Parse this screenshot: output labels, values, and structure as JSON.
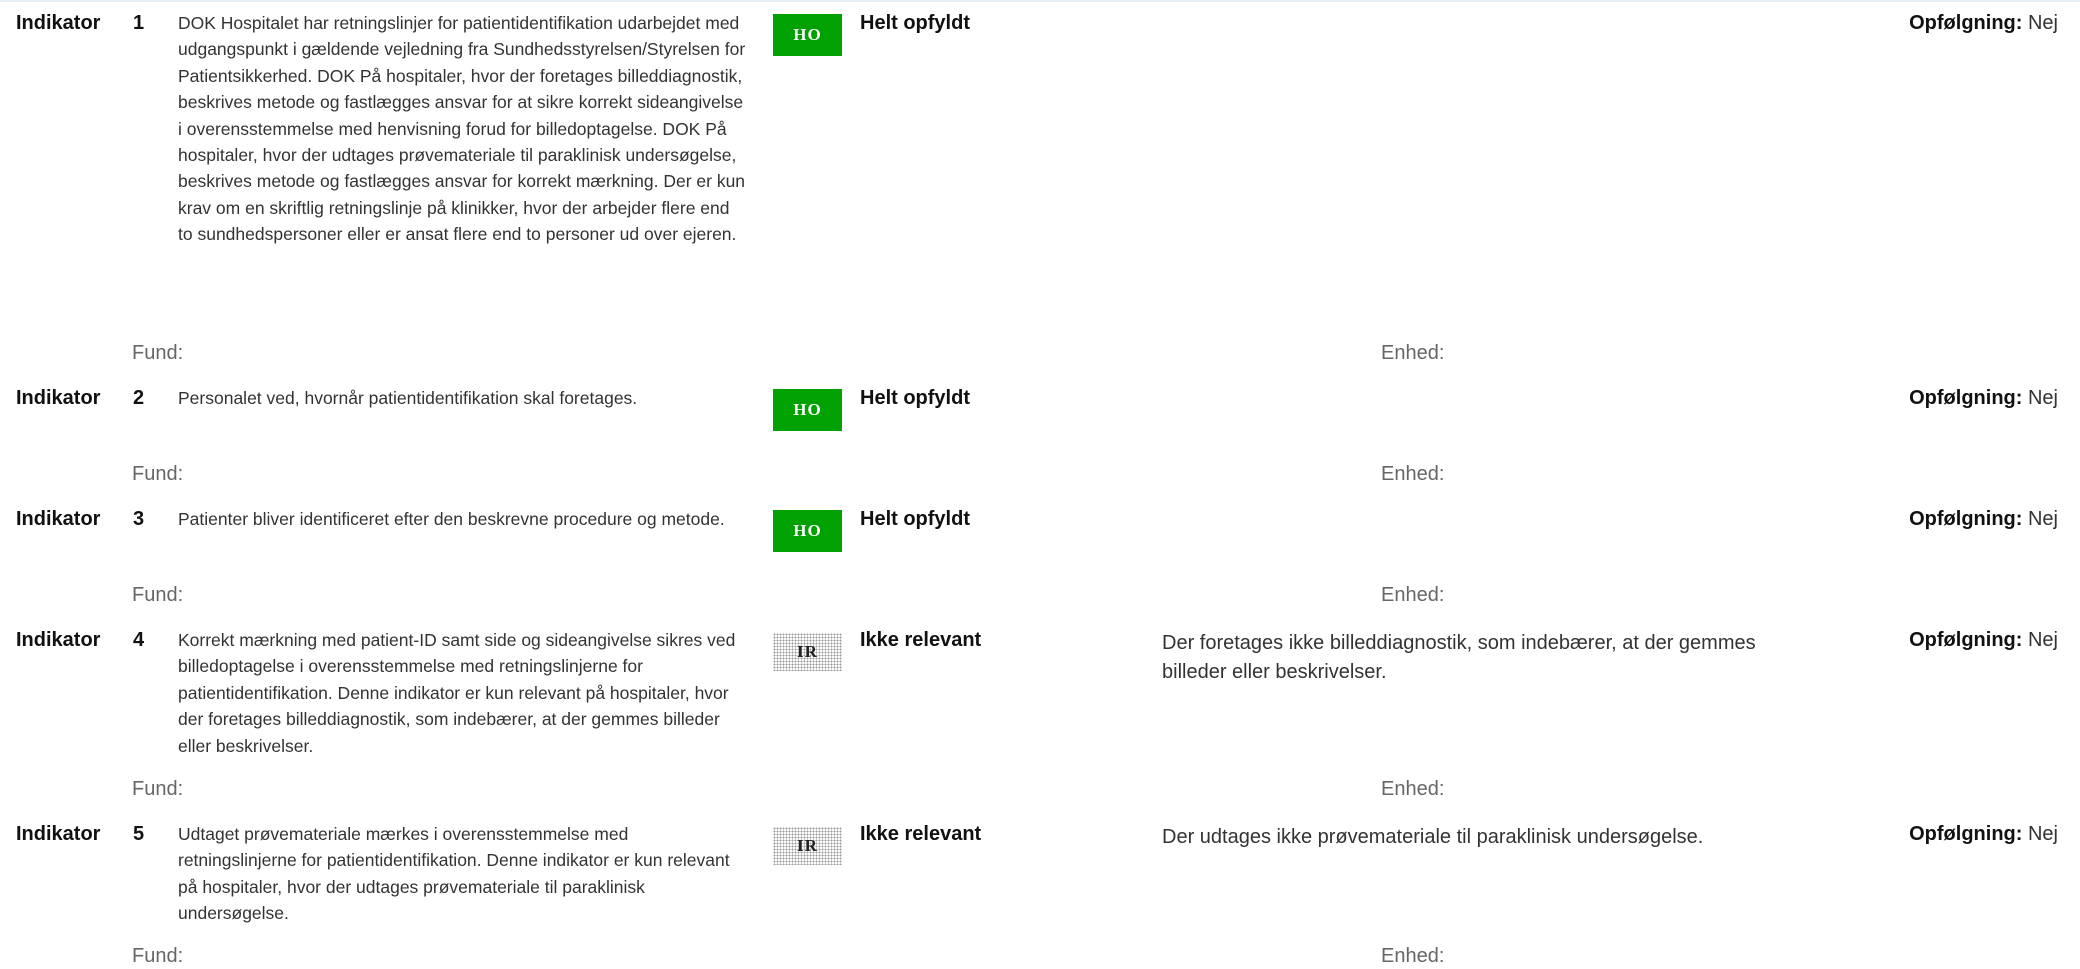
{
  "labels": {
    "indikator": "Indikator",
    "fund": "Fund:",
    "enhed": "Enhed:",
    "opfolgning": "Opfølgning:"
  },
  "badges": {
    "ho": "HO",
    "ir": "IR"
  },
  "colors": {
    "ho_green": "#00a100",
    "ir_pattern": "#9a9a9a"
  },
  "indicators": [
    {
      "number": "1",
      "text": "DOK Hospitalet har retningslinjer for patientidentifikation udarbejdet med udgangspunkt i gældende vejledning fra Sundhedsstyrelsen/Styrelsen for Patientsikkerhed.   DOK På hospitaler, hvor der foretages billeddiagnostik, beskrives metode og fastlægges ansvar for at sikre korrekt sideangivelse i overensstemmelse med henvisning forud for billedoptagelse.   DOK På hospitaler, hvor der udtages prøvemateriale til paraklinisk undersøgelse, beskrives metode og fastlægges ansvar for korrekt mærkning.   Der er kun krav om en skriftlig retningslinje på klinikker, hvor der arbejder flere end to sundhedspersoner eller er ansat flere end to personer ud over ejeren.",
      "status": "Helt opfyldt",
      "comment": "",
      "followup": "Nej"
    },
    {
      "number": "2",
      "text": "Personalet ved, hvornår patientidentifikation skal foretages.",
      "status": "Helt opfyldt",
      "comment": "",
      "followup": "Nej"
    },
    {
      "number": "3",
      "text": "Patienter bliver identificeret efter den beskrevne procedure og metode.",
      "status": "Helt opfyldt",
      "comment": "",
      "followup": "Nej"
    },
    {
      "number": "4",
      "text": "Korrekt mærkning med patient-ID samt side og sideangivelse sikres ved billedoptagelse i overensstemmelse med retningslinjerne for patientidentifikation.   Denne indikator er kun relevant på hospitaler, hvor der foretages billeddiagnostik, som indebærer, at der gemmes billeder eller beskrivelser.",
      "status": "Ikke relevant",
      "comment": "Der foretages ikke billeddiagnostik, som indebærer, at der gemmes billeder eller beskrivelser.",
      "followup": "Nej"
    },
    {
      "number": "5",
      "text": "Udtaget prøvemateriale mærkes i overensstemmelse med retningslinjerne for patientidentifikation.   Denne indikator er kun relevant på hospitaler, hvor der udtages prøvemateriale til paraklinisk undersøgelse.",
      "status": "Ikke relevant",
      "comment": "Der udtages ikke prøvemateriale til paraklinisk undersøgelse.",
      "followup": "Nej"
    }
  ]
}
